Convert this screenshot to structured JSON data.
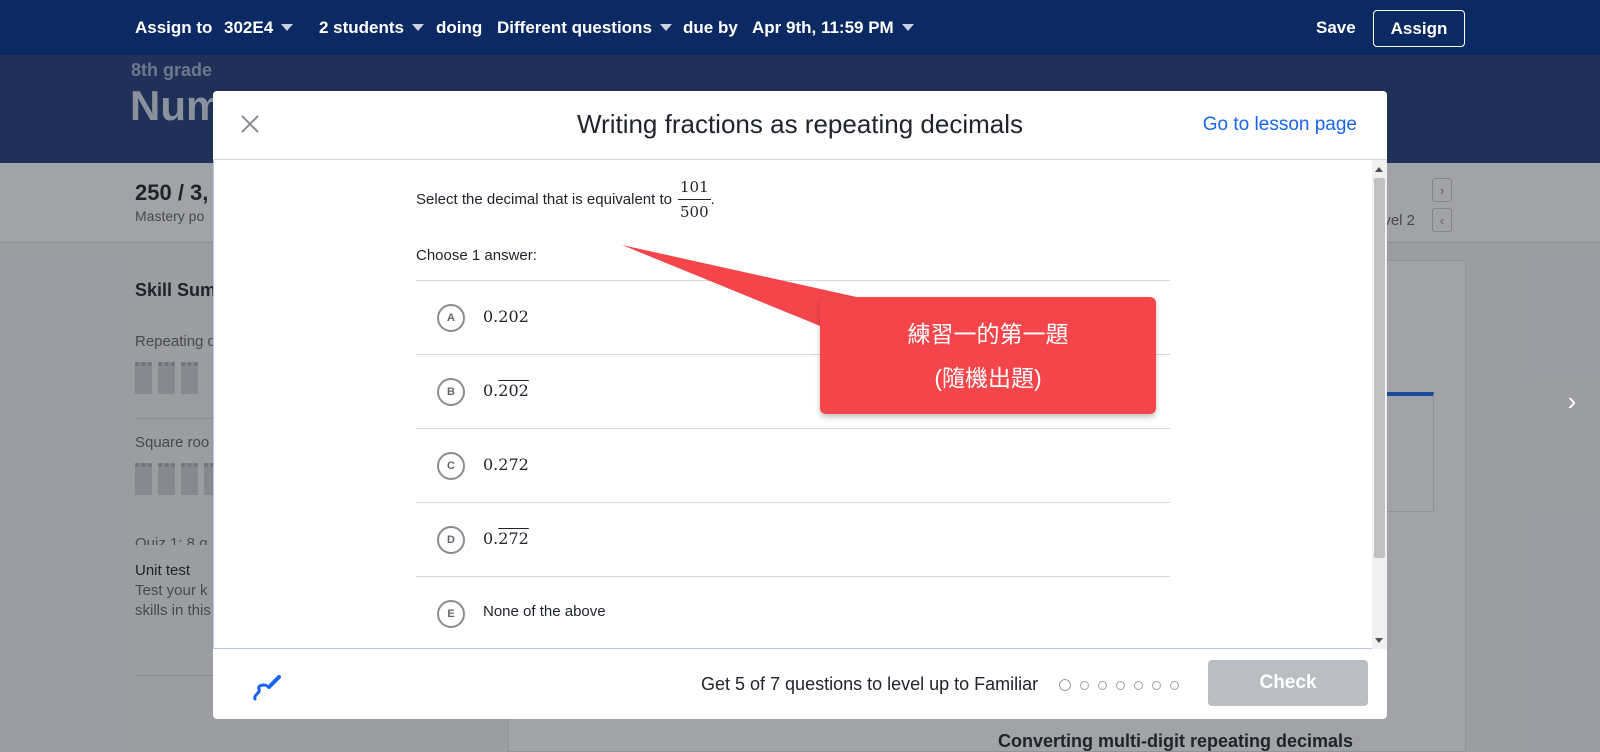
{
  "topbar": {
    "assign_to_label": "Assign to",
    "class_value": "302E4",
    "students_value": "2 students",
    "doing_label": "doing",
    "questions_value": "Different questions",
    "due_by_label": "due by",
    "due_value": "Apr 9th, 11:59 PM",
    "save_label": "Save",
    "assign_label": "Assign"
  },
  "background": {
    "grade": "8th grade",
    "unit_title": "Num",
    "points": "250 / 3,",
    "points_sub": "Mastery po",
    "level_label": "evel 2",
    "skill_summary": "Skill Summ",
    "item_1": "Repeating d",
    "item_2": "Square roo",
    "item_3": "Quiz 1: 8 q",
    "unit_test": "Unit test",
    "unit_test_sub_1": "Test your k",
    "unit_test_sub_2": "skills in this",
    "converting": "Converting multi-digit repeating decimals"
  },
  "modal": {
    "title": "Writing fractions as repeating decimals",
    "lesson_link": "Go to lesson page",
    "question_prefix": "Select the decimal that is equivalent to",
    "fraction_numerator": "101",
    "fraction_denominator": "500",
    "question_suffix": ".",
    "choose_label": "Choose 1 answer:",
    "choices": [
      {
        "letter": "A",
        "whole": "0.202",
        "repeat": ""
      },
      {
        "letter": "B",
        "whole": "0.",
        "repeat": "202"
      },
      {
        "letter": "C",
        "whole": "0.272",
        "repeat": ""
      },
      {
        "letter": "D",
        "whole": "0.",
        "repeat": "272"
      },
      {
        "letter": "E",
        "whole": "None of the above",
        "repeat": ""
      }
    ],
    "footer_text": "Get 5 of 7 questions to level up to Familiar",
    "progress_total": 7,
    "progress_done": 0,
    "check_label": "Check"
  },
  "annotation": {
    "line_1": "練習一的第一題",
    "line_2": "(隨機出題)",
    "color": "#f4464a"
  },
  "colors": {
    "topbar": "#0b2a63",
    "link": "#1865f2",
    "check_disabled": "#babec2"
  }
}
